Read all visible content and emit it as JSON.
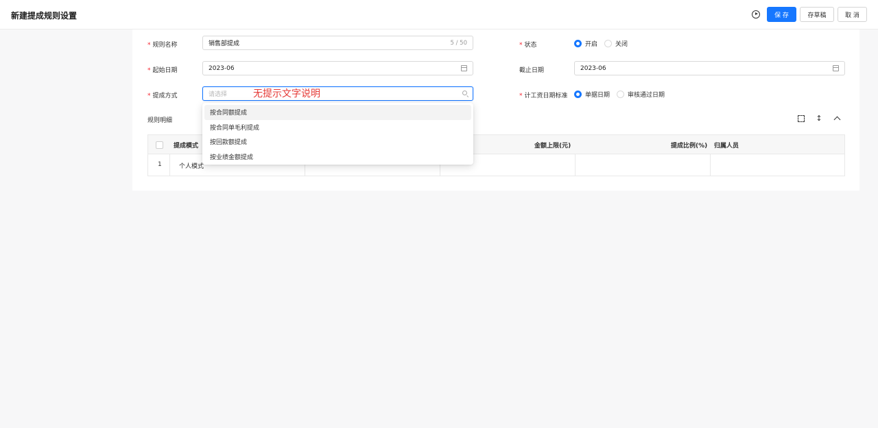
{
  "header": {
    "title": "新建提成规则设置",
    "save_label": "保 存",
    "draft_label": "存草稿",
    "cancel_label": "取 消"
  },
  "form": {
    "rule_name": {
      "label": "规则名称",
      "value": "销售部提成",
      "count": "5 / 50"
    },
    "status": {
      "label": "状态",
      "options": [
        "开启",
        "关闭"
      ],
      "selected": "开启"
    },
    "start_date": {
      "label": "起始日期",
      "value": "2023-06"
    },
    "end_date": {
      "label": "截止日期",
      "value": "2023-06"
    },
    "method": {
      "label": "提成方式",
      "placeholder": "请选择"
    },
    "salary_date_standard": {
      "label": "计工资日期标准",
      "options": [
        "单据日期",
        "审核通过日期"
      ],
      "selected": "单据日期"
    }
  },
  "annotation": "无提示文字说明",
  "details": {
    "label": "规则明细",
    "columns": [
      "提成模式",
      "金额上限(元)",
      "提成比例(%)",
      "归属人员"
    ],
    "rows": [
      {
        "index": "1",
        "mode": "个人模式"
      }
    ]
  },
  "dropdown": {
    "options": [
      "按合同额提成",
      "按合同单毛利提成",
      "按回款额提成",
      "按业绩金额提成"
    ]
  },
  "colors": {
    "primary": "#1677ff",
    "required": "#f5222d",
    "annotation": "#e53935"
  }
}
